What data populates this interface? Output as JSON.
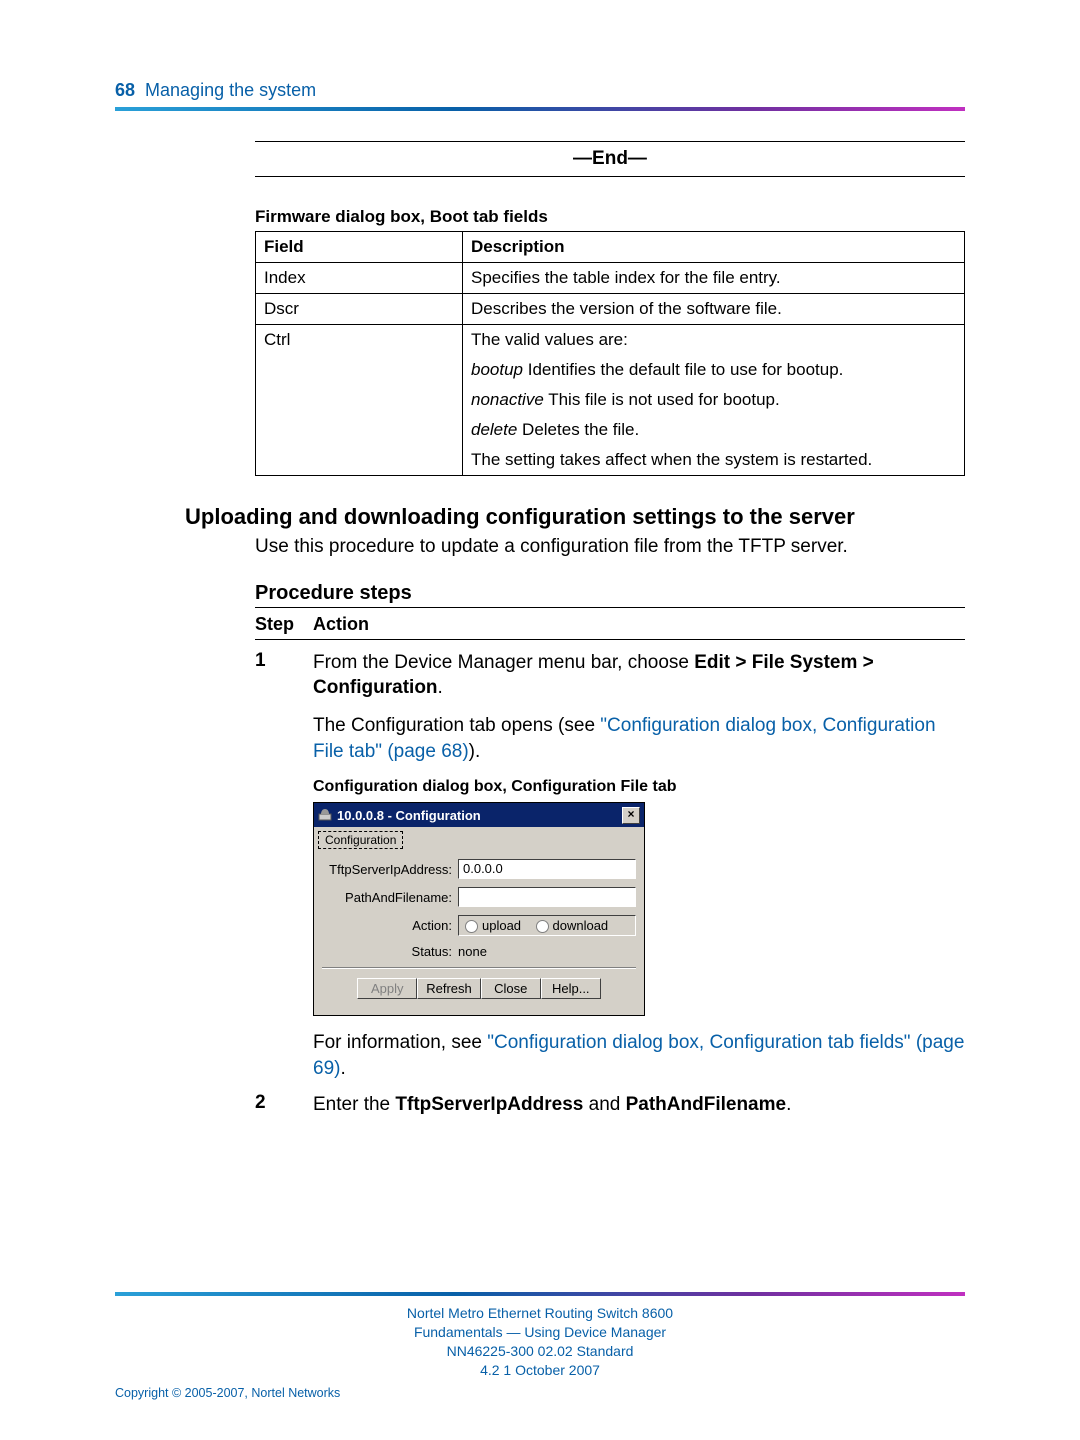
{
  "header": {
    "page_number": "68",
    "chapter": "Managing the system"
  },
  "end_marker": "—End—",
  "table1": {
    "caption": "Firmware dialog box, Boot tab fields",
    "head_field": "Field",
    "head_desc": "Description",
    "rows": {
      "r0f": "Index",
      "r0d": "Specifies the table index for the file entry.",
      "r1f": "Dscr",
      "r1d": "Describes the version of the software file.",
      "r2f": "Ctrl",
      "r2d1": "The valid values are:",
      "r2i1": "bootup",
      "r2t1": " Identifies the default file to use for bootup.",
      "r2i2": "nonactive",
      "r2t2": " This file is not used for bootup.",
      "r2i3": "delete",
      "r2t3": " Deletes the file.",
      "r2d2": "The setting takes affect when the system is restarted."
    }
  },
  "section": {
    "title": "Uploading and downloading configuration settings to the server",
    "intro": "Use this procedure to update a configuration file from the TFTP server."
  },
  "procedure": {
    "heading": "Procedure steps",
    "col_step": "Step",
    "col_action": "Action",
    "step1": {
      "num": "1",
      "pre": "From the Device Manager menu bar, choose ",
      "menu": "Edit > File System > Configuration",
      "post": ".",
      "sentence2a": "The Configuration tab opens (see ",
      "link1": "\"Configuration dialog box, Configuration File tab\" (page 68)",
      "sentence2b": ").",
      "caption": "Configuration dialog box, Configuration File tab",
      "after1": "For information, see ",
      "link2": "\"Configuration dialog box, Configuration tab fields\" (page 69)",
      "after2": "."
    },
    "step2": {
      "num": "2",
      "pre": "Enter the ",
      "b1": "TftpServerIpAddress",
      "mid": " and ",
      "b2": "PathAndFilename",
      "post": "."
    }
  },
  "dialog": {
    "title": "10.0.0.8 - Configuration",
    "tab": "Configuration",
    "label_ip": "TftpServerIpAddress:",
    "value_ip": "0.0.0.0",
    "label_path": "PathAndFilename:",
    "label_action": "Action:",
    "opt_upload": "upload",
    "opt_download": "download",
    "label_status": "Status:",
    "value_status": "none",
    "btn_apply": "Apply",
    "btn_refresh": "Refresh",
    "btn_close": "Close",
    "btn_help": "Help..."
  },
  "footer": {
    "l1": "Nortel Metro Ethernet Routing Switch 8600",
    "l2": "Fundamentals — Using Device Manager",
    "l3": "NN46225-300   02.02   Standard",
    "l4": "4.2   1 October 2007",
    "copyright": "Copyright © 2005-2007, Nortel Networks"
  }
}
